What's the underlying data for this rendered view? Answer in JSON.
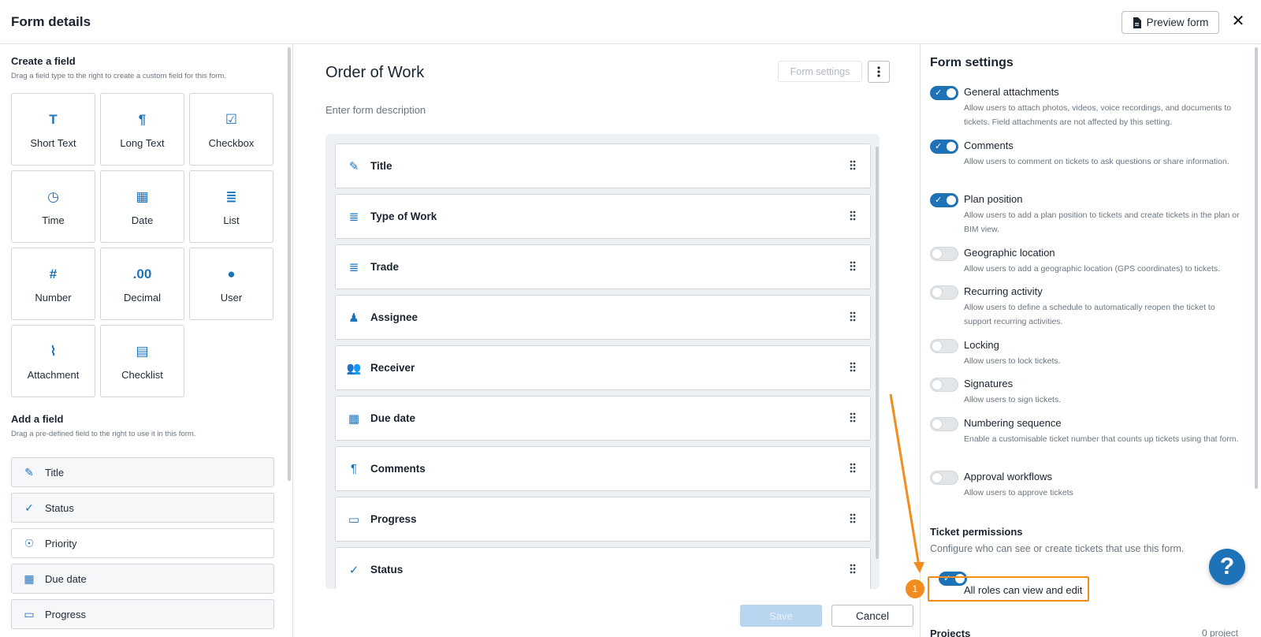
{
  "header": {
    "title": "Form details",
    "preview_label": "Preview form",
    "close_glyph": "✕"
  },
  "left": {
    "create_title": "Create a field",
    "create_sub": "Drag a field type to the right to create a custom field for this form.",
    "tiles": [
      {
        "label": "Short Text",
        "icon": "short-text-icon",
        "glyph": "T"
      },
      {
        "label": "Long Text",
        "icon": "paragraph-icon",
        "glyph": "¶"
      },
      {
        "label": "Checkbox",
        "icon": "checkbox-icon",
        "glyph": "☑"
      },
      {
        "label": "Time",
        "icon": "clock-icon",
        "glyph": "◷"
      },
      {
        "label": "Date",
        "icon": "calendar-icon",
        "glyph": "▦"
      },
      {
        "label": "List",
        "icon": "list-icon",
        "glyph": "≣"
      },
      {
        "label": "Number",
        "icon": "hash-icon",
        "glyph": "#"
      },
      {
        "label": "Decimal",
        "icon": "decimal-icon",
        "glyph": ".00"
      },
      {
        "label": "User",
        "icon": "user-icon",
        "glyph": "●"
      },
      {
        "label": "Attachment",
        "icon": "paperclip-icon",
        "glyph": "⌇"
      },
      {
        "label": "Checklist",
        "icon": "clipboard-icon",
        "glyph": "▤"
      }
    ],
    "add_title": "Add a field",
    "add_sub": "Drag a pre-defined field to the right to use it in this form.",
    "fields": [
      {
        "label": "Title",
        "icon": "edit-icon",
        "glyph": "✎"
      },
      {
        "label": "Status",
        "icon": "check-icon",
        "glyph": "✓"
      },
      {
        "label": "Priority",
        "icon": "medal-icon",
        "glyph": "☉"
      },
      {
        "label": "Due date",
        "icon": "calendar-icon",
        "glyph": "▦"
      },
      {
        "label": "Progress",
        "icon": "progress-icon",
        "glyph": "▭"
      }
    ]
  },
  "middle": {
    "form_title": "Order of Work",
    "form_desc": "Enter form description",
    "settings_label": "Form settings",
    "fields": [
      {
        "label": "Title",
        "icon": "edit-icon",
        "glyph": "✎"
      },
      {
        "label": "Type of Work",
        "icon": "list-icon",
        "glyph": "≣"
      },
      {
        "label": "Trade",
        "icon": "list-icon",
        "glyph": "≣"
      },
      {
        "label": "Assignee",
        "icon": "worker-icon",
        "glyph": "♟"
      },
      {
        "label": "Receiver",
        "icon": "users-icon",
        "glyph": "👥"
      },
      {
        "label": "Due date",
        "icon": "calendar-icon",
        "glyph": "▦"
      },
      {
        "label": "Comments",
        "icon": "paragraph-icon",
        "glyph": "¶"
      },
      {
        "label": "Progress",
        "icon": "progress-icon",
        "glyph": "▭"
      },
      {
        "label": "Status",
        "icon": "check-icon",
        "glyph": "✓"
      }
    ],
    "save_label": "Save",
    "cancel_label": "Cancel"
  },
  "right": {
    "title": "Form settings",
    "settings": [
      {
        "name": "General attachments",
        "desc": "Allow users to attach photos, videos, voice recordings, and documents to tickets. Field attachments are not affected by this setting.",
        "on": true
      },
      {
        "name": "Comments",
        "desc": "Allow users to comment on tickets to ask questions or share information.",
        "on": true
      },
      {
        "name": "Plan position",
        "desc": "Allow users to add a plan position to tickets and create tickets in the plan or BIM view.",
        "on": true
      },
      {
        "name": "Geographic location",
        "desc": "Allow users to add a geographic location (GPS coordinates) to tickets.",
        "on": false
      },
      {
        "name": "Recurring activity",
        "desc": "Allow users to define a schedule to automatically reopen the ticket to support recurring activities.",
        "on": false
      },
      {
        "name": "Locking",
        "desc": "Allow users to lock tickets.",
        "on": false
      },
      {
        "name": "Signatures",
        "desc": "Allow users to sign tickets.",
        "on": false
      },
      {
        "name": "Numbering sequence",
        "desc": "Enable a customisable ticket number that counts up tickets using that form.",
        "on": false
      },
      {
        "name": "Approval workflows",
        "desc": "Allow users to approve tickets",
        "on": false
      }
    ],
    "permissions_title": "Ticket permissions",
    "permissions_desc": "Configure who can see or create tickets that use this form.",
    "permission_toggle": {
      "name": "All roles can view and edit",
      "on": true
    },
    "projects_label": "Projects",
    "projects_count": "0 project"
  },
  "annotation": {
    "step": "1"
  },
  "help": {
    "glyph": "?"
  },
  "colors": {
    "accent": "#1e72b8",
    "annotation": "#f28c1e"
  }
}
